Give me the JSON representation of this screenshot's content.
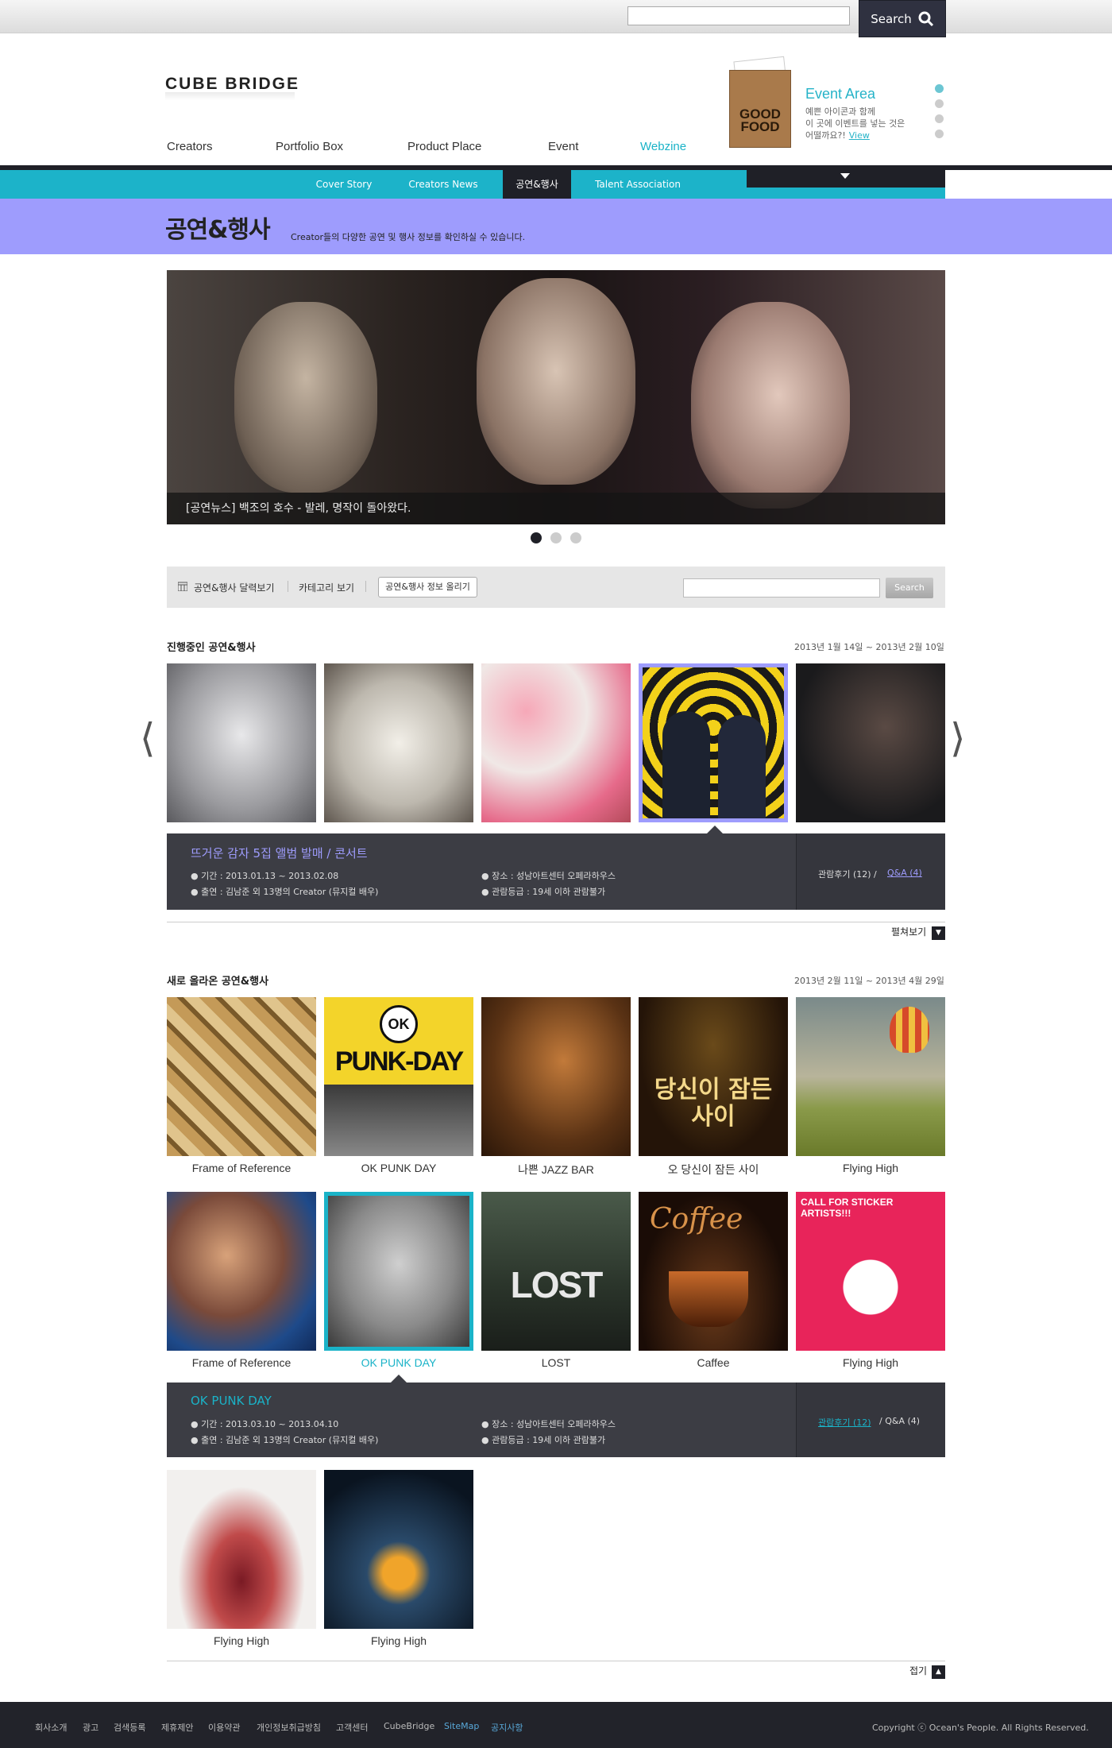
{
  "topbar": {
    "search_label": "Search"
  },
  "header": {
    "logo": "CUBE BRIDGE",
    "gnb": [
      "Creators",
      "Portfolio Box",
      "Product Place",
      "Event",
      "Webzine"
    ],
    "event": {
      "bag_text": "GOOD FOOD",
      "title": "Event Area",
      "desc_line1": "예쁜 아이콘과 함께",
      "desc_line2": "이 곳에 이벤트를 넣는 것은",
      "desc_line3": "어떨까요?!",
      "view_label": "View"
    }
  },
  "subnav": [
    "Cover Story",
    "Creators News",
    "공연&행사",
    "Talent Association"
  ],
  "page": {
    "title": "공연&행사",
    "desc": "Creator들의 다양한 공연 및 행사 정보를 확인하실 수 있습니다."
  },
  "hero": {
    "caption": "[공연뉴스] 백조의 호수 - 발레, 명작이 돌아왔다."
  },
  "toolbar": {
    "calendar": "공연&행사 달력보기",
    "category": "카테고리 보기",
    "upload": "공연&행사 정보 올리기",
    "search_label": "Search"
  },
  "ongoing": {
    "title": "진행중인 공연&행사",
    "date": "2013년 1월 14일 ~ 2013년 2월 10일",
    "panel": {
      "title": "뜨거운 감자 5집 앨범 발매 / 콘서트",
      "period": "● 기간 : 2013.01.13 ~ 2013.02.08",
      "cast": "● 출연 : 김남준 외 13명의 Creator (뮤지컬 배우)",
      "place": "● 장소 : 성남아트센터 오페라하우스",
      "rating": "● 관람등급 : 19세 이하 관람불가",
      "review": "관람후기 (12) /",
      "qa": "Q&A (4)"
    },
    "expand": "펼쳐보기"
  },
  "newly": {
    "title": "새로 올라온 공연&행사",
    "date": "2013년 2월 11일 ~ 2013년 4월 29일",
    "row1": [
      "Frame of Reference",
      "OK PUNK DAY",
      "나쁜 JAZZ BAR",
      "오 당신이 잠든 사이",
      "Flying High"
    ],
    "row2": [
      "Frame of Reference",
      "OK PUNK DAY",
      "LOST",
      "Caffee",
      "Flying High"
    ],
    "row3": [
      "Flying High",
      "Flying High"
    ],
    "poster_text": {
      "punk": "PUNK-DAY",
      "ok": "OK",
      "musical": "당신이 잠든사이",
      "lost": "LOST",
      "coffee": "Coffee",
      "sticker": "CALL FOR STICKER ARTISTS!!!"
    },
    "panel": {
      "title": "OK PUNK DAY",
      "period": "● 기간 : 2013.03.10 ~ 2013.04.10",
      "cast": "● 출연 : 김남준 외 13명의 Creator (뮤지컬 배우)",
      "place": "● 장소 : 성남아트센터 오페라하우스",
      "rating": "● 관람등급 : 19세 이하 관람불가",
      "review": "관람후기 (12)",
      "qa": "/ Q&A (4)"
    },
    "collapse": "접기"
  },
  "footer": {
    "links": [
      "회사소개",
      "광고",
      "검색등록",
      "제휴제안",
      "이용약관",
      "개인정보취급방침",
      "고객센터",
      "CubeBridge",
      "SiteMap",
      "공지사항"
    ],
    "copyright": "Copyright ⓒ Ocean's People. All Rights Reserved."
  },
  "colors": {
    "accent": "#1ab3c8",
    "band": "#9e9cfd",
    "dark": "#1f2027",
    "panel": "#3c3d44"
  }
}
